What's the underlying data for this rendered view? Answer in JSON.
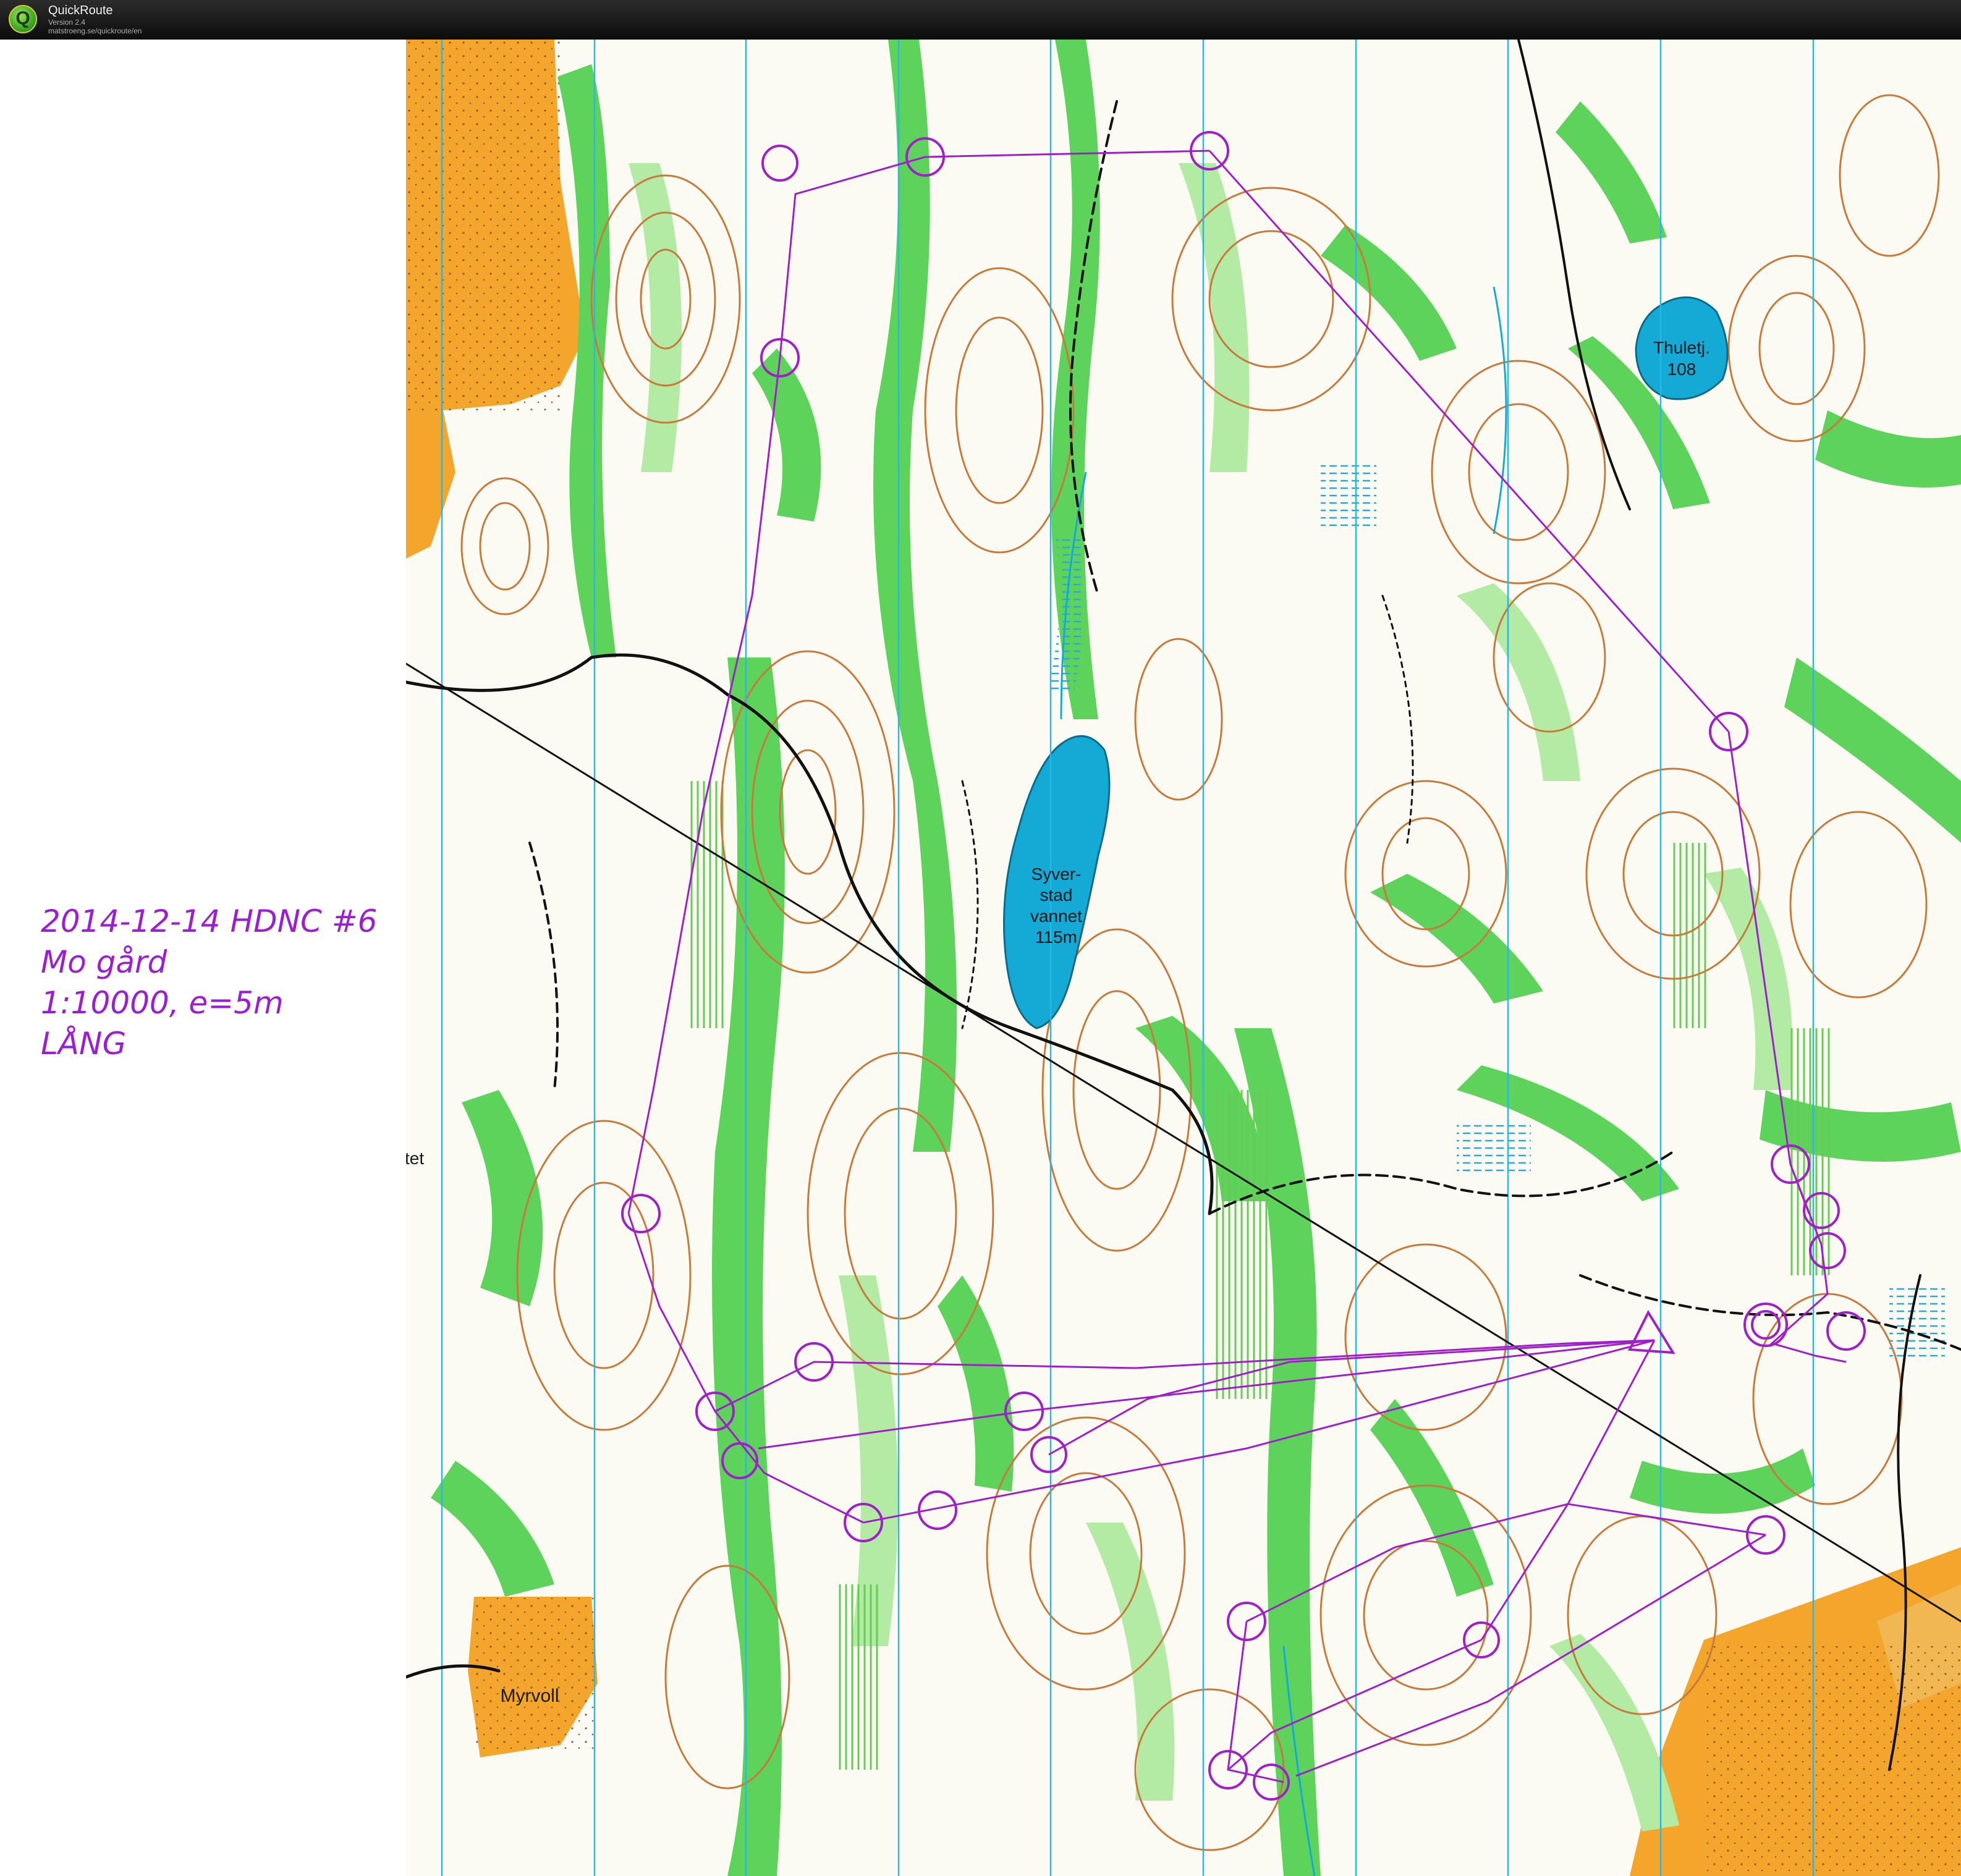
{
  "app": {
    "name": "QuickRoute",
    "version": "Version 2.4",
    "url": "matstroeng.se/quickroute/en"
  },
  "annotation": {
    "lines": [
      "2014-12-14 HDNC #6",
      "Mo gård",
      "1:10000, e=5m",
      "LÅNG"
    ],
    "color": "#9b1fd0"
  },
  "map": {
    "labels": {
      "lake_main": [
        "Syver-",
        "stad",
        "vannet",
        "115m"
      ],
      "lake_ne": [
        "Thuletj.",
        "108"
      ],
      "farm_sw": "Myrvoll",
      "edge_west": "tet"
    },
    "colors": {
      "course": "#a020c8",
      "water": "#15a9d6",
      "open_land": "#f4a52c",
      "forest_green": "#5ed35c",
      "light_green": "#b3eaa4",
      "contour": "#c87a3a",
      "north_lines": "#29b6e8"
    }
  }
}
